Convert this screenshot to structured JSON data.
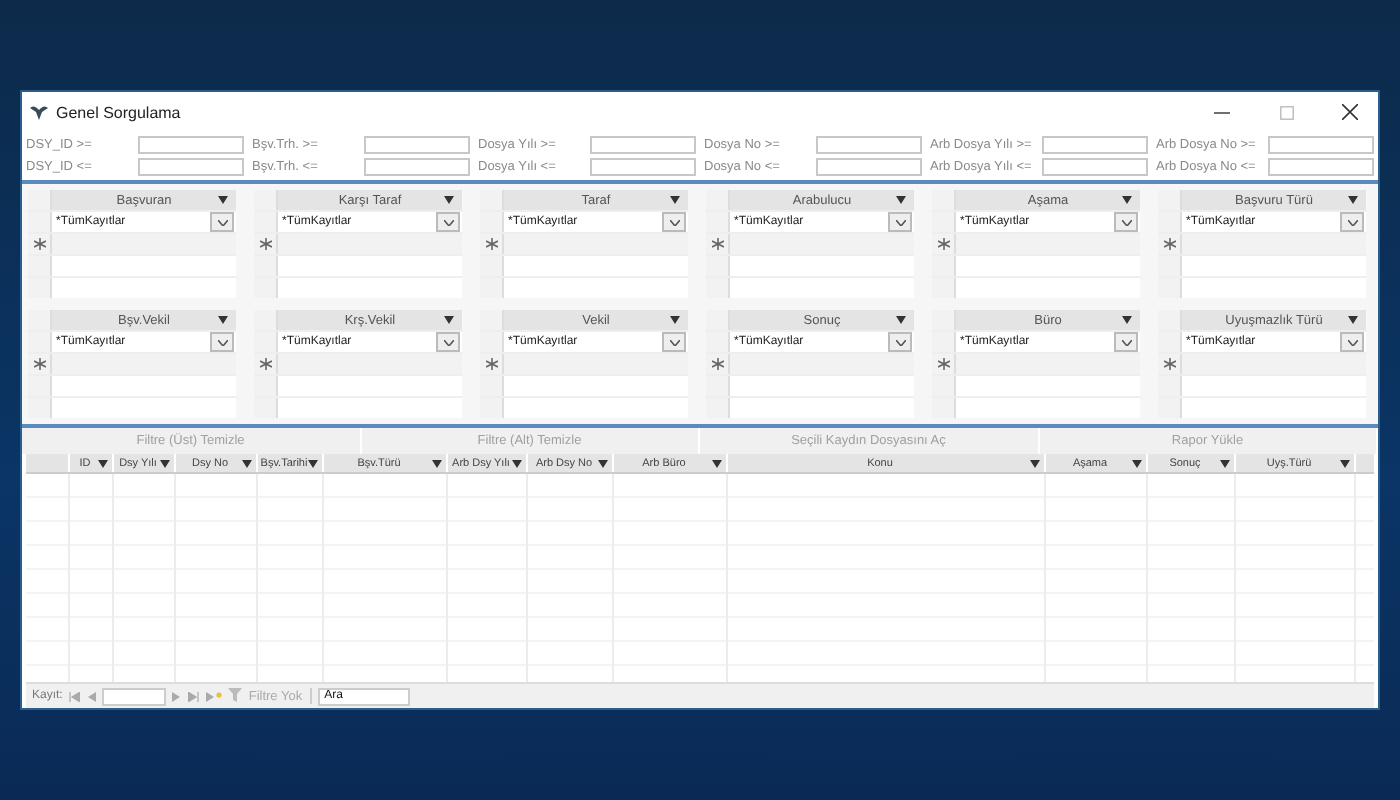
{
  "window": {
    "title": "Genel Sorgulama"
  },
  "filters": [
    {
      "label": "DSY_ID >="
    },
    {
      "label": "Bşv.Trh. >="
    },
    {
      "label": "Dosya Yılı >="
    },
    {
      "label": "Dosya No >="
    },
    {
      "label": "Arb Dosya Yılı >="
    },
    {
      "label": "Arb Dosya No >="
    },
    {
      "label": "DSY_ID <="
    },
    {
      "label": "Bşv.Trh. <="
    },
    {
      "label": "Dosya Yılı <="
    },
    {
      "label": "Dosya No <="
    },
    {
      "label": "Arb Dosya Yılı <="
    },
    {
      "label": "Arb Dosya No <="
    }
  ],
  "subforms": [
    {
      "header": "Başvuran",
      "value": "*TümKayıtlar"
    },
    {
      "header": "Karşı Taraf",
      "value": "*TümKayıtlar"
    },
    {
      "header": "Taraf",
      "value": "*TümKayıtlar"
    },
    {
      "header": "Arabulucu",
      "value": "*TümKayıtlar"
    },
    {
      "header": "Aşama",
      "value": "*TümKayıtlar"
    },
    {
      "header": "Başvuru Türü",
      "value": "*TümKayıtlar"
    },
    {
      "header": "Bşv.Vekil",
      "value": "*TümKayıtlar"
    },
    {
      "header": "Krş.Vekil",
      "value": "*TümKayıtlar"
    },
    {
      "header": "Vekil",
      "value": "*TümKayıtlar"
    },
    {
      "header": "Sonuç",
      "value": "*TümKayıtlar"
    },
    {
      "header": "Büro",
      "value": "*TümKayıtlar"
    },
    {
      "header": "Uyuşmazlık Türü",
      "value": "*TümKayıtlar"
    }
  ],
  "buttons": [
    "Filtre (Üst) Temizle",
    "Filtre (Alt) Temizle",
    "Seçili Kaydın Dosyasını Aç",
    "Rapor Yükle"
  ],
  "table": {
    "columns": [
      "ID",
      "Dsy Yılı",
      "Dsy No",
      "Bşv.Tarihi",
      "Bşv.Türü",
      "Arb Dsy Yılı",
      "Arb Dsy No",
      "Arb Büro",
      "Konu",
      "Aşama",
      "Sonuç",
      "Uyş.Türü"
    ]
  },
  "nav_bar": {
    "label": "Kayıt:",
    "filter": "Filtre Yok",
    "search": "Ara"
  }
}
